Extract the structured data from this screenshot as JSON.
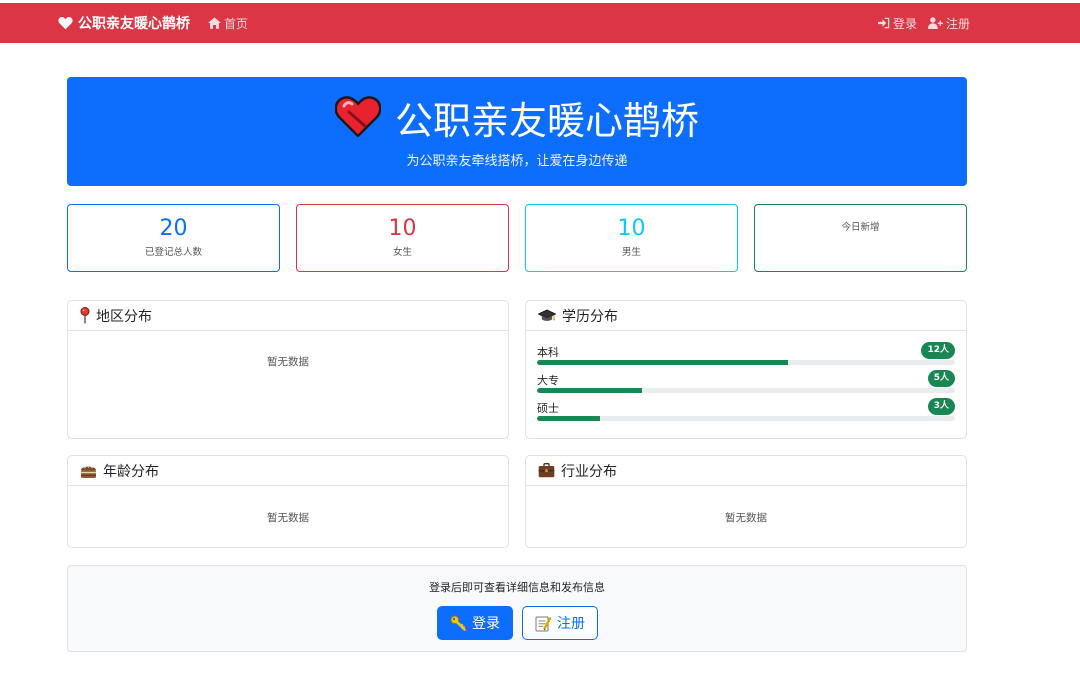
{
  "navbar": {
    "brand": "公职亲友暖心鹊桥",
    "home_label": "首页",
    "login_label": "登录",
    "register_label": "注册",
    "background": "#dc3545"
  },
  "hero": {
    "title": "公职亲友暖心鹊桥",
    "subtitle": "为公职亲友牵线搭桥，让爱在身边传递",
    "icon": "heart-icon",
    "background": "#0d6efd"
  },
  "stats": [
    {
      "value": "20",
      "label": "已登记总人数",
      "color": "#0d6efd"
    },
    {
      "value": "10",
      "label": "女生",
      "color": "#dc3545"
    },
    {
      "value": "10",
      "label": "男生",
      "color": "#0dcaf0"
    },
    {
      "value": "",
      "label": "今日新增",
      "color": "#198754"
    }
  ],
  "panels": {
    "region": {
      "title": "地区分布",
      "icon": "pin-icon",
      "empty": "暂无数据"
    },
    "education": {
      "title": "学历分布",
      "icon": "graduation-cap-icon",
      "items": [
        {
          "label": "本科",
          "count": "12人",
          "fraction": 0.6
        },
        {
          "label": "大专",
          "count": "5人",
          "fraction": 0.25
        },
        {
          "label": "硕士",
          "count": "3人",
          "fraction": 0.15
        }
      ]
    },
    "age": {
      "title": "年龄分布",
      "icon": "cake-icon",
      "empty": "暂无数据"
    },
    "industry": {
      "title": "行业分布",
      "icon": "briefcase-icon",
      "empty": "暂无数据"
    }
  },
  "login_box": {
    "prompt": "登录后即可查看详细信息和发布信息",
    "login_button": "登录",
    "login_icon": "key-icon",
    "register_button": "注册",
    "register_icon": "memo-icon"
  }
}
